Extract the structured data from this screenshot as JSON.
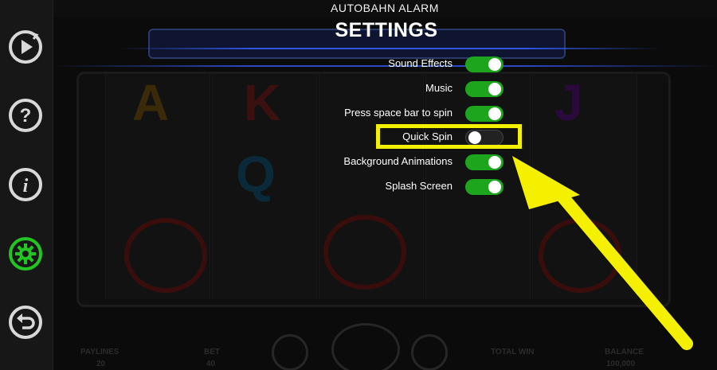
{
  "app": {
    "title": "AUTOBAHN ALARM"
  },
  "sidebar": {
    "buttons": [
      {
        "name": "autoplay",
        "icon": "play-circle-icon"
      },
      {
        "name": "help",
        "icon": "question-circle-icon"
      },
      {
        "name": "info",
        "icon": "info-circle-icon"
      },
      {
        "name": "settings",
        "icon": "gear-icon",
        "active": true
      },
      {
        "name": "back",
        "icon": "back-arrow-icon"
      }
    ],
    "active_color": "#22c522",
    "default_color": "#d8d8d8"
  },
  "settings": {
    "title": "SETTINGS",
    "items": [
      {
        "label": "Sound Effects",
        "on": true
      },
      {
        "label": "Music",
        "on": true
      },
      {
        "label": "Press space bar to spin",
        "on": true
      },
      {
        "label": "Quick Spin",
        "on": false
      },
      {
        "label": "Background Animations",
        "on": true
      },
      {
        "label": "Splash Screen",
        "on": true
      }
    ],
    "toggle_on_color": "#1ea51e"
  },
  "annotation": {
    "highlight_color": "#f4f000",
    "highlighted_item": "Quick Spin"
  },
  "background": {
    "bottom_labels": {
      "paylines": "PAYLINES",
      "bet": "BET",
      "total_win": "TOTAL WIN",
      "balance": "BALANCE"
    },
    "bottom_values": {
      "paylines": "20",
      "bet": "40",
      "balance": "100,000"
    }
  }
}
